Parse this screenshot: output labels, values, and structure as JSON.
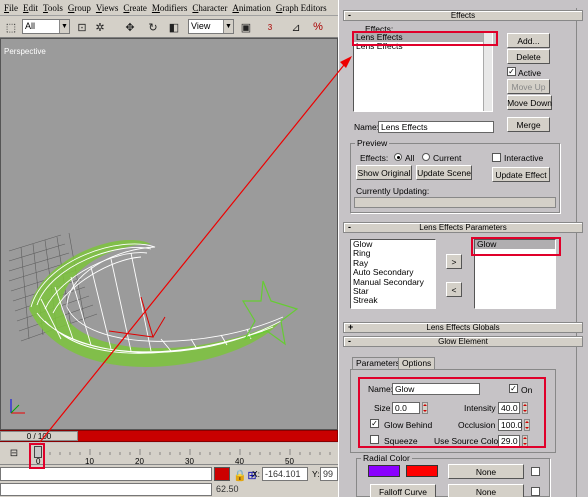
{
  "menu": [
    "File",
    "Edit",
    "Tools",
    "Group",
    "Views",
    "Create",
    "Modifiers",
    "Character",
    "Animation",
    "Graph Editors"
  ],
  "toolbar": {
    "selection_filter": "All",
    "ref_coord": "View",
    "snap_label": "3",
    "angle_snap": "%"
  },
  "viewport": {
    "label": "Perspective"
  },
  "timeline": {
    "frame_display": "0 / 100",
    "ticks": [
      "0",
      "10",
      "20",
      "30",
      "40",
      "50"
    ]
  },
  "status": {
    "x_label": "X:",
    "x_value": "-164.101",
    "y_label": "Y:",
    "y_value": "99",
    "zoom_value": "62.50"
  },
  "effects": {
    "title": "Effects",
    "list_label": "Effects:",
    "list_items": [
      "Lens Effects",
      "Lens Effects"
    ],
    "add": "Add...",
    "delete": "Delete",
    "active": "Active",
    "move_up": "Move Up",
    "move_down": "Move Down",
    "name_label": "Name:",
    "name_value": "Lens Effects",
    "merge": "Merge",
    "preview_title": "Preview",
    "effects_label": "Effects:",
    "all": "All",
    "current": "Current",
    "interactive": "Interactive",
    "show_original": "Show Original",
    "update_scene": "Update Scene",
    "update_effect": "Update Effect",
    "currently_updating": "Currently Updating:"
  },
  "lens_params": {
    "title": "Lens Effects Parameters",
    "available": [
      "Glow",
      "Ring",
      "Ray",
      "Auto Secondary",
      "Manual Secondary",
      "Star",
      "Streak"
    ],
    "arrow_right": ">",
    "arrow_left": "<",
    "active": [
      "Glow"
    ]
  },
  "globals": {
    "title": "Lens Effects Globals",
    "toggle": "+"
  },
  "glow_element": {
    "title": "Glow Element",
    "toggle": "-",
    "tab_parameters": "Parameters",
    "tab_options": "Options",
    "name_label": "Name:",
    "name_value": "Glow",
    "on": "On",
    "size_label": "Size",
    "size_value": "0.0",
    "intensity_label": "Intensity",
    "intensity_value": "40.0",
    "glow_behind": "Glow Behind",
    "occlusion_label": "Occlusion",
    "occlusion_value": "100.0",
    "squeeze": "Squeeze",
    "use_source_color_label": "Use Source Color",
    "use_source_color_value": "29.0",
    "radial_color_title": "Radial Color",
    "none1": "None",
    "none2": "None",
    "falloff_curve": "Falloff Curve",
    "color1": "#8a00ff",
    "color2": "#ff0000"
  },
  "roll_minus": "-"
}
